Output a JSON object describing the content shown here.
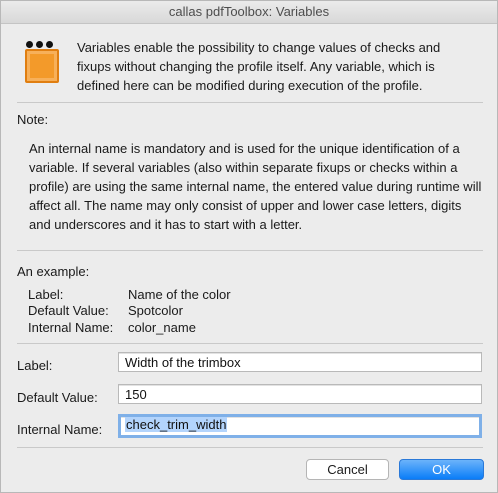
{
  "window": {
    "title": "callas pdfToolbox: Variables"
  },
  "intro": "Variables enable the possibility to change values of checks and fixups without changing the profile itself. Any variable, which is defined here can be modified during execution of the profile.",
  "note": {
    "label": "Note:",
    "body": "An internal name is mandatory and is used for the unique identification of a variable. If several variables (also within separate fixups or checks within a profile) are using the same internal name, the entered value during runtime will affect all. The name may only consist of upper and lower case letters, digits and underscores and it has to start with a letter."
  },
  "example": {
    "label": "An example:",
    "rows": [
      {
        "key": "Label:",
        "value": "Name of the color"
      },
      {
        "key": "Default Value:",
        "value": "Spotcolor"
      },
      {
        "key": "Internal Name:",
        "value": "color_name"
      }
    ]
  },
  "form": {
    "label": {
      "label": "Label:",
      "value": "Width of the trimbox"
    },
    "default_value": {
      "label": "Default Value:",
      "value": "150"
    },
    "internal_name": {
      "label": "Internal Name:",
      "value": "check_trim_width"
    }
  },
  "buttons": {
    "cancel": "Cancel",
    "ok": "OK"
  },
  "colors": {
    "accent": "#0a7df8",
    "focus_ring": "#7fb0e8",
    "selection": "#b3d4fc",
    "icon_orange": "#f39a2a"
  },
  "icons": {
    "app": "pdftoolbox-variables-icon"
  }
}
